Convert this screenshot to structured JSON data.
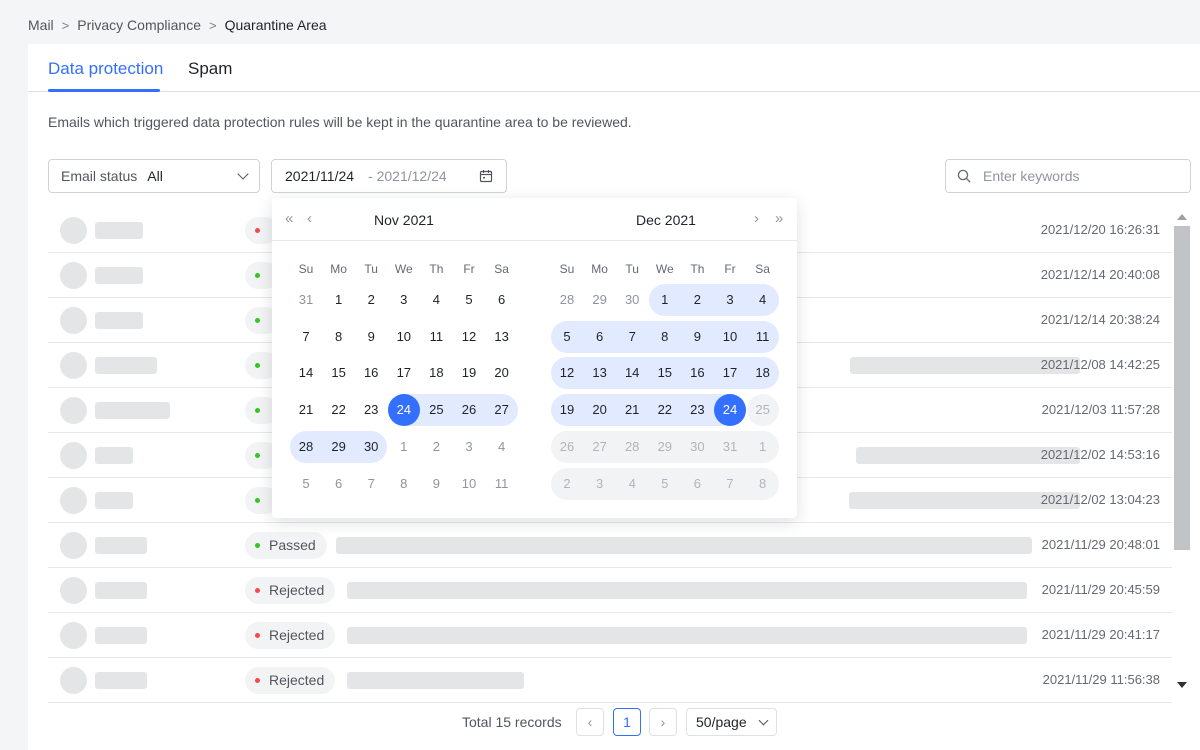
{
  "breadcrumb": {
    "items": [
      "Mail",
      "Privacy Compliance",
      "Quarantine Area"
    ]
  },
  "tabs": [
    {
      "label": "Data protection",
      "active": true
    },
    {
      "label": "Spam",
      "active": false
    }
  ],
  "description": "Emails which triggered data protection rules will be kept in the quarantine area to be reviewed.",
  "filters": {
    "status_label": "Email status",
    "status_value": "All",
    "date_start": "2021/11/24",
    "date_end": "- 2021/12/24",
    "search_placeholder": "Enter keywords"
  },
  "table": {
    "rows": [
      {
        "status": "",
        "status_color": "#f54a45",
        "time": "2021/12/20 16:26:31"
      },
      {
        "status": "",
        "status_color": "#34c724",
        "time": "2021/12/14 20:40:08"
      },
      {
        "status": "",
        "status_color": "#34c724",
        "time": "2021/12/14 20:38:24"
      },
      {
        "status": "",
        "status_color": "#34c724",
        "time": "2021/12/08 14:42:25"
      },
      {
        "status": "",
        "status_color": "#34c724",
        "time": "2021/12/03 11:57:28"
      },
      {
        "status": "",
        "status_color": "#34c724",
        "time": "2021/12/02 14:53:16"
      },
      {
        "status": "",
        "status_color": "#34c724",
        "time": "2021/12/02 13:04:23"
      },
      {
        "status": "Passed",
        "status_color": "#34c724",
        "time": "2021/11/29 20:48:01"
      },
      {
        "status": "Rejected",
        "status_color": "#f54a45",
        "time": "2021/11/29 20:45:59"
      },
      {
        "status": "Rejected",
        "status_color": "#f54a45",
        "time": "2021/11/29 20:41:17"
      },
      {
        "status": "Rejected",
        "status_color": "#f54a45",
        "time": "2021/11/29 11:56:38"
      }
    ]
  },
  "pagination": {
    "total": "Total 15 records",
    "current_page": "1",
    "page_size": "50/page"
  },
  "date_picker": {
    "nav_prev_year": "«",
    "nav_prev_month": "‹",
    "nav_next_month": "›",
    "nav_next_year": "»",
    "weekdays": [
      "Su",
      "Mo",
      "Tu",
      "We",
      "Th",
      "Fr",
      "Sa"
    ],
    "left": {
      "title": "Nov 2021",
      "days": [
        "31",
        "1",
        "2",
        "3",
        "4",
        "5",
        "6",
        "7",
        "8",
        "9",
        "10",
        "11",
        "12",
        "13",
        "14",
        "15",
        "16",
        "17",
        "18",
        "19",
        "20",
        "21",
        "22",
        "23",
        "24",
        "25",
        "26",
        "27",
        "28",
        "29",
        "30",
        "1",
        "2",
        "3",
        "4",
        "5",
        "6",
        "7",
        "8",
        "9",
        "10",
        "11"
      ]
    },
    "right": {
      "title": "Dec 2021",
      "days": [
        "28",
        "29",
        "30",
        "1",
        "2",
        "3",
        "4",
        "5",
        "6",
        "7",
        "8",
        "9",
        "10",
        "11",
        "12",
        "13",
        "14",
        "15",
        "16",
        "17",
        "18",
        "19",
        "20",
        "21",
        "22",
        "23",
        "24",
        "25",
        "26",
        "27",
        "28",
        "29",
        "30",
        "31",
        "1",
        "2",
        "3",
        "4",
        "5",
        "6",
        "7",
        "8"
      ]
    }
  },
  "colors": {
    "accent": "#3370ff",
    "range": "#e1eaff",
    "passed": "#34c724",
    "rejected": "#f54a45"
  }
}
